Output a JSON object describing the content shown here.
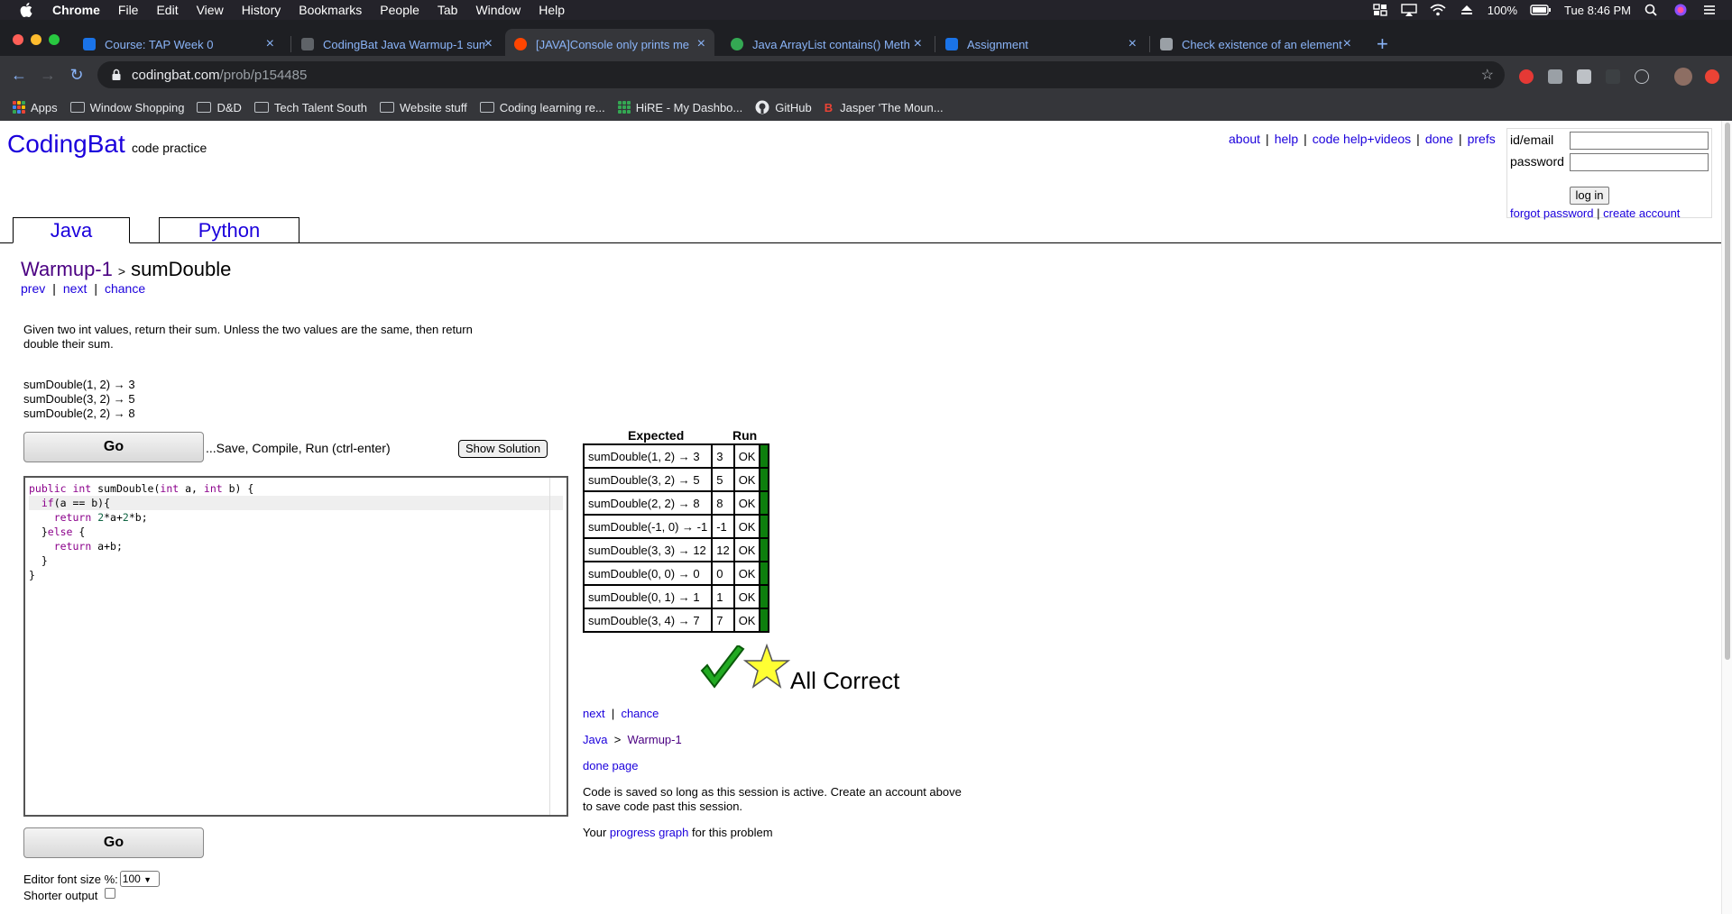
{
  "menubar": {
    "app": "Chrome",
    "items": [
      "File",
      "Edit",
      "View",
      "History",
      "Bookmarks",
      "People",
      "Tab",
      "Window",
      "Help"
    ],
    "battery": "100%",
    "clock": "Tue 8:46 PM"
  },
  "tabs": [
    {
      "title": "Course: TAP Week 0",
      "favicon_color": "#1a73e8"
    },
    {
      "title": "CodingBat Java Warmup-1 sum",
      "favicon_color": "#5f6368"
    },
    {
      "title": "[JAVA]Console only prints me",
      "favicon_color": "#ff4500"
    },
    {
      "title": "Java ArrayList contains() Meth",
      "favicon_color": "#34a853"
    },
    {
      "title": "Assignment",
      "favicon_color": "#1a73e8"
    },
    {
      "title": "Check existence of an element",
      "favicon_color": "#9aa0a6"
    }
  ],
  "address": {
    "host": "codingbat.com",
    "path": "/prob/p154485"
  },
  "bookmarks": [
    "Apps",
    "Window Shopping",
    "D&D",
    "Tech Talent South",
    "Website stuff",
    "Coding learning re...",
    "HiRE - My Dashbo...",
    "GitHub",
    "Jasper 'The Moun..."
  ],
  "site": {
    "logo": "CodingBat",
    "tagline": "code practice",
    "toplinks": [
      "about",
      "help",
      "code help+videos",
      "done",
      "prefs"
    ],
    "login": {
      "id_label": "id/email",
      "password_label": "password",
      "button": "log in",
      "forgot": "forgot password",
      "create": "create account"
    },
    "lang_tabs": [
      "Java",
      "Python"
    ]
  },
  "problem": {
    "section": "Warmup-1",
    "name": "sumDouble",
    "nav": [
      "prev",
      "next",
      "chance"
    ],
    "description_line1": "Given two int values, return their sum. Unless the two values are the same, then return",
    "description_line2": "double their sum.",
    "examples": [
      "sumDouble(1, 2) → 3",
      "sumDouble(3, 2) → 5",
      "sumDouble(2, 2) → 8"
    ],
    "go_label": "Go",
    "go_hint": "...Save, Compile, Run (ctrl-enter)",
    "show_solution": "Show Solution"
  },
  "code_lines": [
    "public int sumDouble(int a, int b) {",
    "  if(a == b){",
    "    return 2*a+2*b;",
    "  }else {",
    "    return a+b;",
    "  }",
    "}"
  ],
  "results": {
    "expected_header": "Expected",
    "run_header": "Run",
    "rows": [
      {
        "expected": "sumDouble(1, 2) → 3",
        "run": "3",
        "status": "OK"
      },
      {
        "expected": "sumDouble(3, 2) → 5",
        "run": "5",
        "status": "OK"
      },
      {
        "expected": "sumDouble(2, 2) → 8",
        "run": "8",
        "status": "OK"
      },
      {
        "expected": "sumDouble(-1, 0) → -1",
        "run": "-1",
        "status": "OK"
      },
      {
        "expected": "sumDouble(3, 3) → 12",
        "run": "12",
        "status": "OK"
      },
      {
        "expected": "sumDouble(0, 0) → 0",
        "run": "0",
        "status": "OK"
      },
      {
        "expected": "sumDouble(0, 1) → 1",
        "run": "1",
        "status": "OK"
      },
      {
        "expected": "sumDouble(3, 4) → 7",
        "run": "7",
        "status": "OK"
      }
    ],
    "pass_color": "#0d7f0d",
    "all_correct": "All Correct"
  },
  "after": {
    "next": "next",
    "chance": "chance",
    "crumb_lang": "Java",
    "crumb_sep": ">",
    "crumb_section": "Warmup-1",
    "done_page": "done page",
    "save_note_line1": "Code is saved so long as this session is active. Create an account above",
    "save_note_line2": "to save code past this session.",
    "progress_prefix": "Your",
    "progress_link": "progress graph",
    "progress_suffix": "for this problem"
  },
  "settings": {
    "font_size_label": "Editor font size %:",
    "font_size_value": "100",
    "shorter_output_label": "Shorter output"
  }
}
